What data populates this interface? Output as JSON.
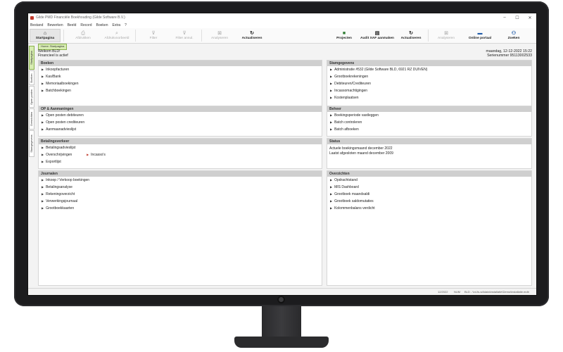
{
  "window": {
    "title": "Gilde PMD Financiële Boekhouding (Gilde Software B.V.)",
    "controls": [
      "–",
      "☐",
      "✕"
    ]
  },
  "menu": [
    "Bestand",
    "Bewerken",
    "Beeld",
    "Record",
    "Boeken",
    "Extra",
    "?"
  ],
  "toolbar": {
    "startpagina": "Startpagina",
    "afdrukken": "Afdrukken",
    "afdrukvoorbeeld": "Afdrukvoorbeeld",
    "filter": "Filter",
    "filter_annuleren": "Filter annul.",
    "analyseren": "Analyseren",
    "actualiseren": "Actualiseren",
    "projecten": "Projecten",
    "audit_xaf": "Audit XAF aanmaken",
    "actualiseren2": "Actualiseren",
    "analyseren2": "Analyseren",
    "online_portaal": "Online portaal",
    "zoeken": "Zoeken"
  },
  "side_tabs": [
    "Startpagina",
    "Boeken",
    "Open posten",
    "Overzichten",
    "Stamgegevens"
  ],
  "home_tab": "Home: Startpagina",
  "welcome": {
    "greeting": "Welkom BLD!",
    "financieel": "Financieel is actief",
    "date": "maandag, 12-12-2022 15:22",
    "serial": "Serienummer 95113002533"
  },
  "panels": {
    "boeken": {
      "title": "Boeken",
      "items": [
        "Inkoopfacturen",
        "Kas/Bank",
        "Memoriaalboekingen",
        "Batchboekingen"
      ]
    },
    "stamgegevens": {
      "title": "Stamgegevens",
      "items": [
        "Administratie #532 (Gilde Software BLD, 6921 RZ DUIVEN)",
        "Grootboekrekeningen",
        "Debiteuren/Crediteuren",
        "Incassomachtigingen",
        "Kostenplaatsen"
      ]
    },
    "op": {
      "title": "OP & Aanmaningen",
      "items": [
        "Open posten debiteuren",
        "Open posten crediteuren",
        "Aanmaanadvieslijst"
      ]
    },
    "beheer": {
      "title": "Beheer",
      "items": [
        "Boekingsperiode vastleggen",
        "Batch controleren",
        "Batch afboeken"
      ]
    },
    "betaling": {
      "title": "Betalingsverkeer",
      "items": [
        "Betalingsadvieslijst",
        "Overschrijvingen",
        "Exportlijst"
      ],
      "extra": "Incasso's"
    },
    "status": {
      "title": "Status",
      "lines": [
        "Actuele boekingsmaand december 2022",
        "Laatst afgesloten maand december 2009"
      ]
    },
    "journalen": {
      "title": "Journalen",
      "items": [
        "Inkoop / Verkoop boekingen",
        "Betalingsanalyse",
        "Rekeningoverzicht",
        "Verwerkingsjournaal",
        "Grootboekkaarten"
      ]
    },
    "overzichten": {
      "title": "Overzichten",
      "items": [
        "Opdrachtstand",
        "MIS Dashboard",
        "Grootboek maandsaldi",
        "Grootboek saldomutaties",
        "Kolommenbalans verdicht"
      ]
    }
  },
  "statusbar": {
    "date": "12/2022",
    "num": "NUM",
    "path": "BLD - \\\\nl-fs-sd\\data\\installatie\\Demo\\installatie.mdb"
  }
}
